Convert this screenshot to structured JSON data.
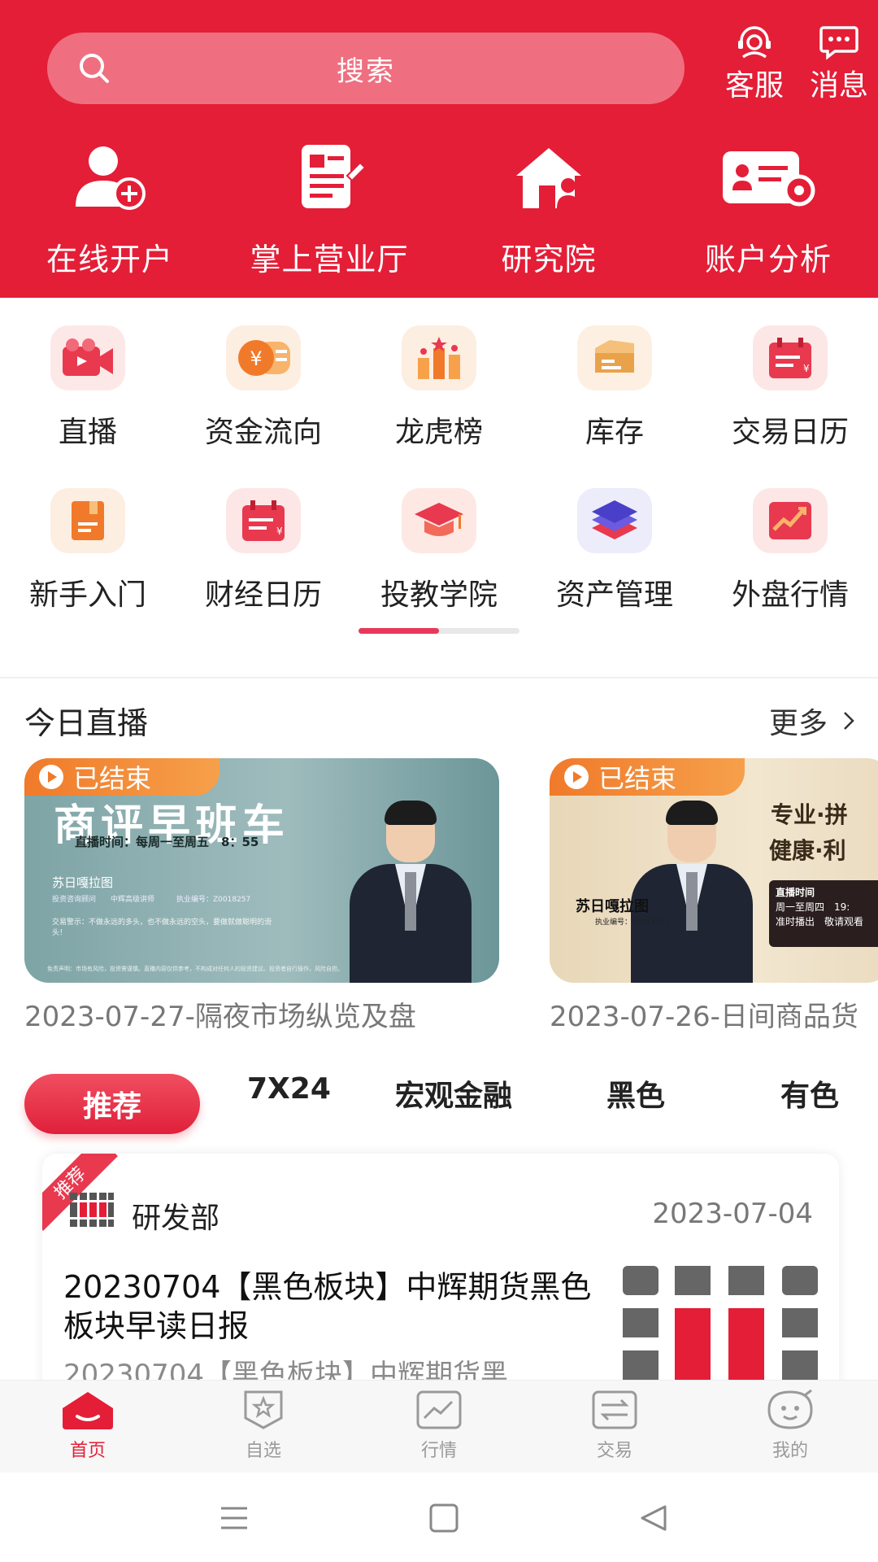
{
  "header": {
    "search_placeholder": "搜索",
    "customer_service_label": "客服",
    "messages_label": "消息",
    "quick_items": [
      {
        "label": "在线开户",
        "icon": "user-add-icon"
      },
      {
        "label": "掌上营业厅",
        "icon": "document-edit-icon"
      },
      {
        "label": "研究院",
        "icon": "house-person-icon"
      },
      {
        "label": "账户分析",
        "icon": "id-card-gear-icon"
      }
    ]
  },
  "grid": {
    "row1": [
      {
        "label": "直播",
        "icon": "video-camera-icon"
      },
      {
        "label": "资金流向",
        "icon": "coin-flow-icon"
      },
      {
        "label": "龙虎榜",
        "icon": "leaderboard-icon"
      },
      {
        "label": "库存",
        "icon": "inventory-box-icon"
      },
      {
        "label": "交易日历",
        "icon": "trading-calendar-icon"
      }
    ],
    "row2": [
      {
        "label": "新手入门",
        "icon": "beginner-book-icon"
      },
      {
        "label": "财经日历",
        "icon": "finance-calendar-icon"
      },
      {
        "label": "投教学院",
        "icon": "graduation-cap-icon"
      },
      {
        "label": "资产管理",
        "icon": "layers-icon"
      },
      {
        "label": "外盘行情",
        "icon": "trend-chart-icon"
      }
    ],
    "page_progress": 0.5
  },
  "live": {
    "title": "今日直播",
    "more_label": "更多",
    "cards": [
      {
        "status": "已结束",
        "poster_title": "商评早班车",
        "poster_time": "直播时间：每周一至周五　8：55",
        "poster_host": "苏日嘎拉图",
        "poster_host_sub": "投资咨询顾问　　中辉高级讲师　　　执业编号：Z0018257",
        "poster_notice": "交易警示：不做永远的多头，也不做永远的空头，要做就做聪明的滑头！",
        "poster_disclaimer": "免责声明：市场有风险，投资需谨慎。直播内容仅供参考，不构成对任何人的投资建议。投资者自行操作，风险自担。",
        "caption": "2023-07-27-隔夜市场纵览及盘"
      },
      {
        "status": "已结束",
        "poster_line1": "专业·拼",
        "poster_line2": "健康·利",
        "poster_host": "苏日嘎拉图",
        "poster_code": "执业编号：Z0018257",
        "poster_box_title": "直播时间",
        "poster_box_days": "周一至周四　19:",
        "poster_box_note": "准时播出　敬请观看",
        "caption": "2023-07-26-日间商品货"
      }
    ]
  },
  "tabs": [
    "推荐",
    "7X24",
    "宏观金融",
    "黑色",
    "有色"
  ],
  "article": {
    "ribbon": "推荐",
    "department": "研发部",
    "date": "2023-07-04",
    "title": "20230704【黑色板块】中辉期货黑色板块早读日报",
    "subtitle": "20230704【黑色板块】中辉期货黑"
  },
  "bottom_nav": [
    {
      "label": "首页",
      "icon": "home-icon",
      "active": true
    },
    {
      "label": "自选",
      "icon": "star-shield-icon",
      "active": false
    },
    {
      "label": "行情",
      "icon": "market-chart-icon",
      "active": false
    },
    {
      "label": "交易",
      "icon": "exchange-arrows-icon",
      "active": false
    },
    {
      "label": "我的",
      "icon": "profile-face-icon",
      "active": false
    }
  ],
  "colors": {
    "brand_red": "#e41e37",
    "accent_orange": "#f07a2a",
    "inactive_gray": "#9a9a9a"
  }
}
